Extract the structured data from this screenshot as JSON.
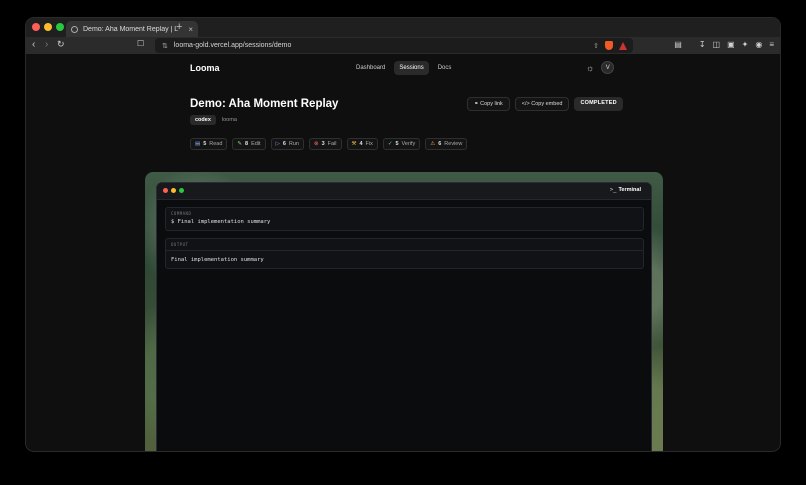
{
  "browser": {
    "tab_title": "Demo: Aha Moment Replay | L",
    "tab_close": "×",
    "new_tab": "+",
    "url": "looma-gold.vercel.app/sessions/demo",
    "colors": {
      "close": "#ff5f57",
      "minimize": "#febc2e",
      "maximize": "#28c840"
    }
  },
  "nav": {
    "logo": "Looma",
    "links": [
      "Dashboard",
      "Sessions",
      "Docs"
    ],
    "active": "Sessions",
    "avatar_initial": "V"
  },
  "session": {
    "title": "Demo: Aha Moment Replay",
    "tag_primary": "codex",
    "tag_secondary": "looma",
    "copy_link": "Copy link",
    "copy_embed": "Copy embed",
    "status": "COMPLETED"
  },
  "stats": [
    {
      "icon": "book-icon",
      "count": "5",
      "label": "Read"
    },
    {
      "icon": "pencil-icon",
      "count": "8",
      "label": "Edit"
    },
    {
      "icon": "play-icon",
      "count": "6",
      "label": "Run"
    },
    {
      "icon": "x-circle-icon",
      "count": "3",
      "label": "Fail"
    },
    {
      "icon": "wrench-icon",
      "count": "4",
      "label": "Fix"
    },
    {
      "icon": "check-circle-icon",
      "count": "5",
      "label": "Verify"
    },
    {
      "icon": "warning-icon",
      "count": "6",
      "label": "Review"
    }
  ],
  "terminal": {
    "label": "Terminal",
    "command_label": "COMMAND",
    "command": "$ Final implementation summary",
    "output_label": "OUTPUT",
    "output": "Final implementation summary"
  }
}
